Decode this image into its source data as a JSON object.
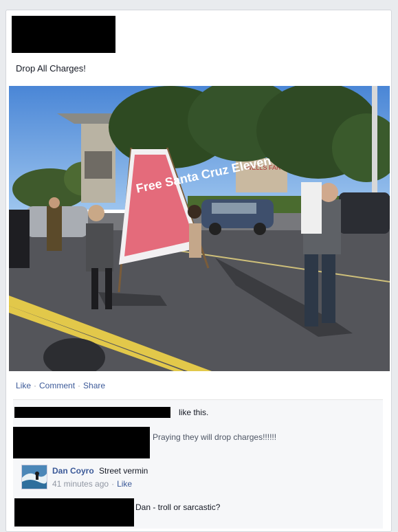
{
  "post": {
    "text": "Drop All Charges!"
  },
  "photo": {
    "banner_text": "Free Santa Cruz Eleven",
    "bank_sign": "WELLS FARGO"
  },
  "actions": {
    "like": "Like",
    "comment": "Comment",
    "share": "Share",
    "separator": "·"
  },
  "likes": {
    "suffix": "like this."
  },
  "comments": [
    {
      "text": "Praying they will drop charges!!!!!!"
    },
    {
      "author": "Dan Coyro",
      "text": "Street vermin",
      "time": "41 minutes ago",
      "like": "Like"
    },
    {
      "text": "Dan - troll or sarcastic?"
    }
  ]
}
